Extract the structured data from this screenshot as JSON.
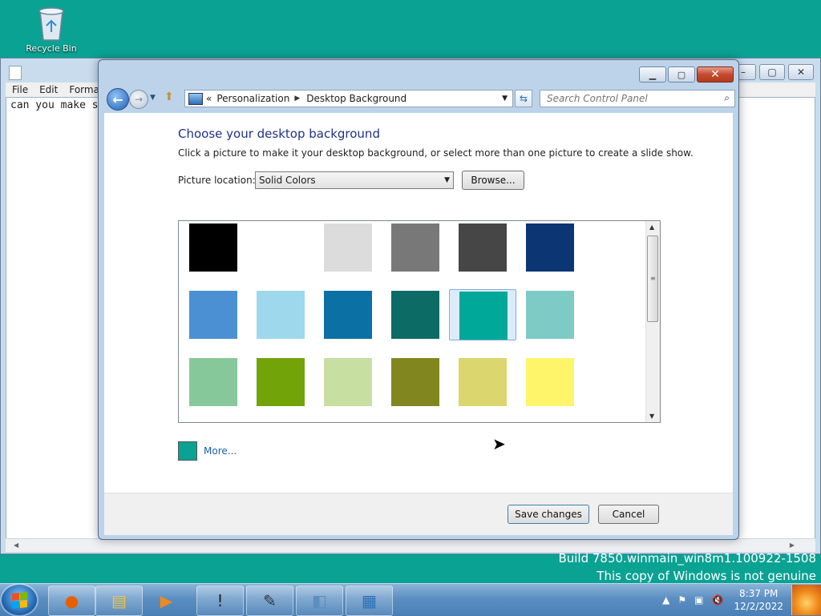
{
  "desktop": {
    "recycle_bin_label": "Recycle Bin"
  },
  "notepad": {
    "menu": [
      "File",
      "Edit",
      "Format"
    ],
    "text": "can you make s"
  },
  "window": {
    "breadcrumb": [
      "Personalization",
      "Desktop Background"
    ],
    "breadcrumb_prefix": "«",
    "search_placeholder": "Search Control Panel",
    "heading": "Choose your desktop background",
    "description": "Click a picture to make it your desktop background, or select more than one picture to create a slide show.",
    "picture_location_label": "Picture location:",
    "picture_location_value": "Solid Colors",
    "browse_label": "Browse...",
    "colors": [
      "#000000",
      "#ffffff",
      "#dcdcdc",
      "#787878",
      "#464646",
      "#0c3573",
      "#4a90d2",
      "#9ed8ec",
      "#0b71a5",
      "#0d6b66",
      "#00a899",
      "#7ecbc5",
      "#86c89a",
      "#72a40a",
      "#c8dfa2",
      "#82861e",
      "#dcd66e",
      "#fff56a"
    ],
    "selected_color_index": 10,
    "more_color": "#0aa293",
    "more_label": "More...",
    "save_label": "Save changes",
    "cancel_label": "Cancel"
  },
  "watermark": {
    "build": "Build 7850.winmain_win8m1.100922-1508",
    "notice": "This copy of Windows is not genuine"
  },
  "taskbar": {
    "apps": [
      "firefox",
      "file-explorer",
      "media-player",
      "paint",
      "notepad-pad",
      "window-app",
      "control-panel"
    ],
    "time": "8:37 PM",
    "date": "12/2/2022"
  }
}
